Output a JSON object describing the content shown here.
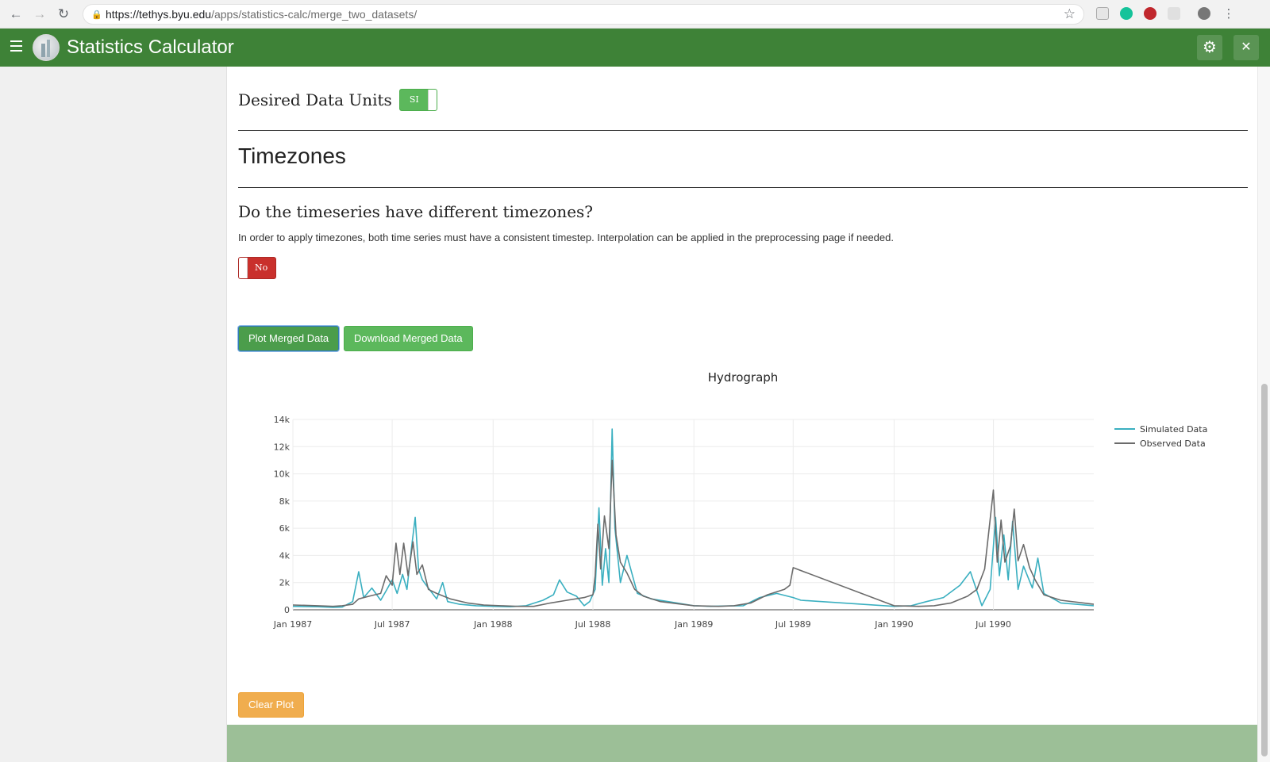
{
  "browser": {
    "url_host": "https://tethys.byu.edu",
    "url_path": "/apps/statistics-calc/merge_two_datasets/"
  },
  "header": {
    "title": "Statistics Calculator"
  },
  "units": {
    "label": "Desired Data Units",
    "toggle_value": "SI"
  },
  "timezones": {
    "heading": "Timezones",
    "question": "Do the timeseries have different timezones?",
    "help_text": "In order to apply timezones, both time series must have a consistent timestep. Interpolation can be applied in the preprocessing page if needed.",
    "toggle_value": "No"
  },
  "actions": {
    "plot_label": "Plot Merged Data",
    "download_label": "Download Merged Data",
    "clear_label": "Clear Plot"
  },
  "colors": {
    "header": "#3e8237",
    "simulated": "#3aafc0",
    "observed": "#6b6b6b",
    "footer": "#9cbf97"
  },
  "chart_data": {
    "type": "line",
    "title": "Hydrograph",
    "xlabel": "",
    "ylabel": "",
    "x_ticks": [
      "Jan 1987",
      "Jul 1987",
      "Jan 1988",
      "Jul 1988",
      "Jan 1989",
      "Jul 1989",
      "Jan 1990",
      "Jul 1990"
    ],
    "y_ticks": [
      "0",
      "2k",
      "4k",
      "6k",
      "8k",
      "10k",
      "12k",
      "14k"
    ],
    "ylim": [
      0,
      14000
    ],
    "xlim": [
      "1987-01-01",
      "1990-12-31"
    ],
    "grid": true,
    "legend_position": "top-right",
    "series": [
      {
        "name": "Simulated Data",
        "points": [
          [
            "1987-01-01",
            250
          ],
          [
            "1987-02-15",
            220
          ],
          [
            "1987-03-15",
            180
          ],
          [
            "1987-04-01",
            200
          ],
          [
            "1987-04-20",
            600
          ],
          [
            "1987-05-01",
            2800
          ],
          [
            "1987-05-10",
            900
          ],
          [
            "1987-05-25",
            1600
          ],
          [
            "1987-06-10",
            700
          ],
          [
            "1987-06-20",
            1400
          ],
          [
            "1987-07-01",
            2200
          ],
          [
            "1987-07-10",
            1200
          ],
          [
            "1987-07-20",
            2600
          ],
          [
            "1987-07-28",
            1500
          ],
          [
            "1987-08-05",
            4500
          ],
          [
            "1987-08-12",
            6800
          ],
          [
            "1987-08-18",
            3000
          ],
          [
            "1987-08-25",
            2200
          ],
          [
            "1987-09-05",
            1600
          ],
          [
            "1987-09-20",
            800
          ],
          [
            "1987-10-01",
            2000
          ],
          [
            "1987-10-10",
            600
          ],
          [
            "1987-11-01",
            400
          ],
          [
            "1987-12-01",
            300
          ],
          [
            "1988-01-01",
            250
          ],
          [
            "1988-02-01",
            220
          ],
          [
            "1988-03-01",
            300
          ],
          [
            "1988-04-01",
            700
          ],
          [
            "1988-04-20",
            1100
          ],
          [
            "1988-05-01",
            2200
          ],
          [
            "1988-05-15",
            1300
          ],
          [
            "1988-06-01",
            1000
          ],
          [
            "1988-06-15",
            300
          ],
          [
            "1988-06-25",
            600
          ],
          [
            "1988-07-05",
            1500
          ],
          [
            "1988-07-12",
            7500
          ],
          [
            "1988-07-18",
            1800
          ],
          [
            "1988-07-24",
            4500
          ],
          [
            "1988-07-30",
            2000
          ],
          [
            "1988-08-05",
            13300
          ],
          [
            "1988-08-10",
            6000
          ],
          [
            "1988-08-20",
            2000
          ],
          [
            "1988-09-01",
            4000
          ],
          [
            "1988-09-20",
            1200
          ],
          [
            "1988-10-15",
            800
          ],
          [
            "1988-11-15",
            600
          ],
          [
            "1988-12-15",
            400
          ],
          [
            "1989-01-01",
            300
          ],
          [
            "1989-02-01",
            250
          ],
          [
            "1989-03-01",
            280
          ],
          [
            "1989-04-01",
            300
          ],
          [
            "1989-05-01",
            900
          ],
          [
            "1989-06-01",
            1200
          ],
          [
            "1989-07-01",
            900
          ],
          [
            "1989-07-15",
            700
          ],
          [
            "1990-01-01",
            250
          ],
          [
            "1990-02-01",
            300
          ],
          [
            "1990-03-01",
            600
          ],
          [
            "1990-04-01",
            900
          ],
          [
            "1990-05-01",
            1800
          ],
          [
            "1990-05-20",
            2800
          ],
          [
            "1990-06-10",
            300
          ],
          [
            "1990-06-25",
            1500
          ],
          [
            "1990-07-05",
            6800
          ],
          [
            "1990-07-12",
            2500
          ],
          [
            "1990-07-20",
            5500
          ],
          [
            "1990-07-28",
            2200
          ],
          [
            "1990-08-05",
            6500
          ],
          [
            "1990-08-15",
            1500
          ],
          [
            "1990-08-25",
            3200
          ],
          [
            "1990-09-10",
            1600
          ],
          [
            "1990-09-20",
            3800
          ],
          [
            "1990-10-01",
            1200
          ],
          [
            "1990-11-01",
            500
          ],
          [
            "1990-12-31",
            300
          ]
        ]
      },
      {
        "name": "Observed Data",
        "points": [
          [
            "1987-01-01",
            350
          ],
          [
            "1987-02-15",
            300
          ],
          [
            "1987-03-15",
            250
          ],
          [
            "1987-04-01",
            300
          ],
          [
            "1987-04-20",
            400
          ],
          [
            "1987-05-01",
            800
          ],
          [
            "1987-05-20",
            1000
          ],
          [
            "1987-06-10",
            1200
          ],
          [
            "1987-06-20",
            2500
          ],
          [
            "1987-07-01",
            1800
          ],
          [
            "1987-07-08",
            4900
          ],
          [
            "1987-07-15",
            2600
          ],
          [
            "1987-07-22",
            4900
          ],
          [
            "1987-07-30",
            2500
          ],
          [
            "1987-08-08",
            5000
          ],
          [
            "1987-08-15",
            2600
          ],
          [
            "1987-08-25",
            3300
          ],
          [
            "1987-09-05",
            1500
          ],
          [
            "1987-09-20",
            1200
          ],
          [
            "1987-10-15",
            800
          ],
          [
            "1987-11-15",
            500
          ],
          [
            "1987-12-15",
            350
          ],
          [
            "1988-01-15",
            300
          ],
          [
            "1988-02-15",
            250
          ],
          [
            "1988-03-15",
            250
          ],
          [
            "1988-04-15",
            500
          ],
          [
            "1988-05-15",
            700
          ],
          [
            "1988-06-15",
            900
          ],
          [
            "1988-07-01",
            1100
          ],
          [
            "1988-07-05",
            2500
          ],
          [
            "1988-07-10",
            6300
          ],
          [
            "1988-07-15",
            3000
          ],
          [
            "1988-07-22",
            6900
          ],
          [
            "1988-07-30",
            4500
          ],
          [
            "1988-08-05",
            11000
          ],
          [
            "1988-08-12",
            5500
          ],
          [
            "1988-08-20",
            3500
          ],
          [
            "1988-09-01",
            2700
          ],
          [
            "1988-09-15",
            1500
          ],
          [
            "1988-10-01",
            1000
          ],
          [
            "1988-11-01",
            600
          ],
          [
            "1988-12-01",
            450
          ],
          [
            "1989-01-01",
            300
          ],
          [
            "1989-02-15",
            250
          ],
          [
            "1989-03-15",
            300
          ],
          [
            "1989-04-15",
            500
          ],
          [
            "1989-05-15",
            1100
          ],
          [
            "1989-06-15",
            1500
          ],
          [
            "1989-06-25",
            1800
          ],
          [
            "1989-07-01",
            3100
          ],
          [
            "1990-01-01",
            300
          ],
          [
            "1990-02-15",
            250
          ],
          [
            "1990-03-15",
            300
          ],
          [
            "1990-04-15",
            500
          ],
          [
            "1990-05-15",
            1000
          ],
          [
            "1990-06-01",
            1500
          ],
          [
            "1990-06-15",
            3000
          ],
          [
            "1990-07-01",
            8800
          ],
          [
            "1990-07-08",
            3500
          ],
          [
            "1990-07-15",
            6600
          ],
          [
            "1990-07-22",
            3500
          ],
          [
            "1990-08-01",
            4700
          ],
          [
            "1990-08-08",
            7400
          ],
          [
            "1990-08-15",
            3600
          ],
          [
            "1990-08-25",
            4800
          ],
          [
            "1990-09-05",
            3100
          ],
          [
            "1990-09-15",
            2200
          ],
          [
            "1990-10-01",
            1100
          ],
          [
            "1990-11-01",
            700
          ],
          [
            "1990-12-31",
            400
          ]
        ]
      }
    ]
  }
}
